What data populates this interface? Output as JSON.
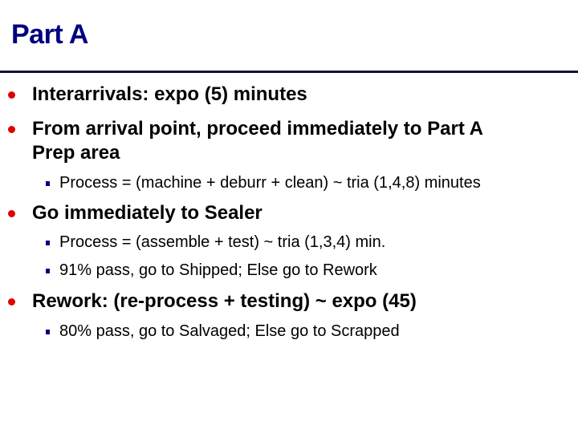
{
  "slide": {
    "title": "Part A",
    "colors": {
      "title": "#000080",
      "rule": "#0f1240",
      "bullet_l1": "#e00000",
      "bullet_l2": "#000080"
    },
    "items": [
      {
        "level": 1,
        "text": "Interarrivals:  expo (5) minutes"
      },
      {
        "level": 1,
        "text": "From arrival point, proceed immediately to Part A",
        "text2": "Prep area"
      },
      {
        "level": 2,
        "text": "Process = (machine + deburr + clean) ~ tria (1,4,8) minutes"
      },
      {
        "level": 1,
        "text": "Go immediately to Sealer"
      },
      {
        "level": 2,
        "text": "Process = (assemble + test) ~ tria (1,3,4) min."
      },
      {
        "level": 2,
        "text": "91% pass, go to Shipped; Else go to Rework"
      },
      {
        "level": 1,
        "text": "Rework: (re-process + testing) ~ expo (45)"
      },
      {
        "level": 2,
        "text": "80% pass, go to Salvaged; Else go to Scrapped"
      }
    ]
  }
}
